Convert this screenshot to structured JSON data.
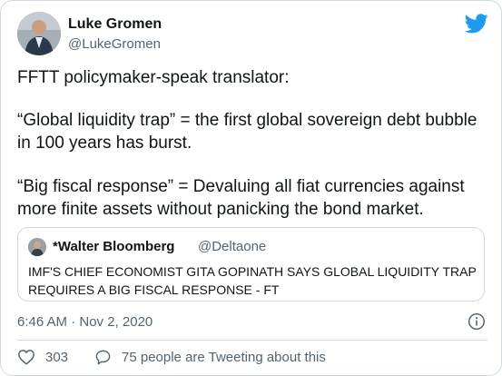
{
  "author": {
    "name": "Luke Gromen",
    "handle": "@LukeGromen"
  },
  "tweet": {
    "paragraphs": [
      "FFTT policymaker-speak translator:",
      "“Global liquidity trap” = the first global sovereign debt bubble in 100 years has burst.",
      "“Big fiscal response” = Devaluing all fiat currencies against more finite assets without panicking the bond market."
    ]
  },
  "quoted_tweet": {
    "name": "*Walter Bloomberg",
    "handle": "@Deltaone",
    "text": "IMF'S CHIEF ECONOMIST GITA GOPINATH SAYS GLOBAL LIQUIDITY TRAP REQUIRES A BIG FISCAL RESPONSE - FT"
  },
  "meta": {
    "timestamp": "6:46 AM · Nov 2, 2020"
  },
  "actions": {
    "like_count": "303",
    "reply_label": "75 people are Tweeting about this"
  },
  "colors": {
    "twitter_blue": "#1d9bf0",
    "secondary_text": "#536471",
    "border": "#cfd9de"
  },
  "icons": {
    "logo": "twitter-bird-icon",
    "info": "info-icon",
    "like": "heart-icon",
    "reply": "comment-bubble-icon"
  }
}
